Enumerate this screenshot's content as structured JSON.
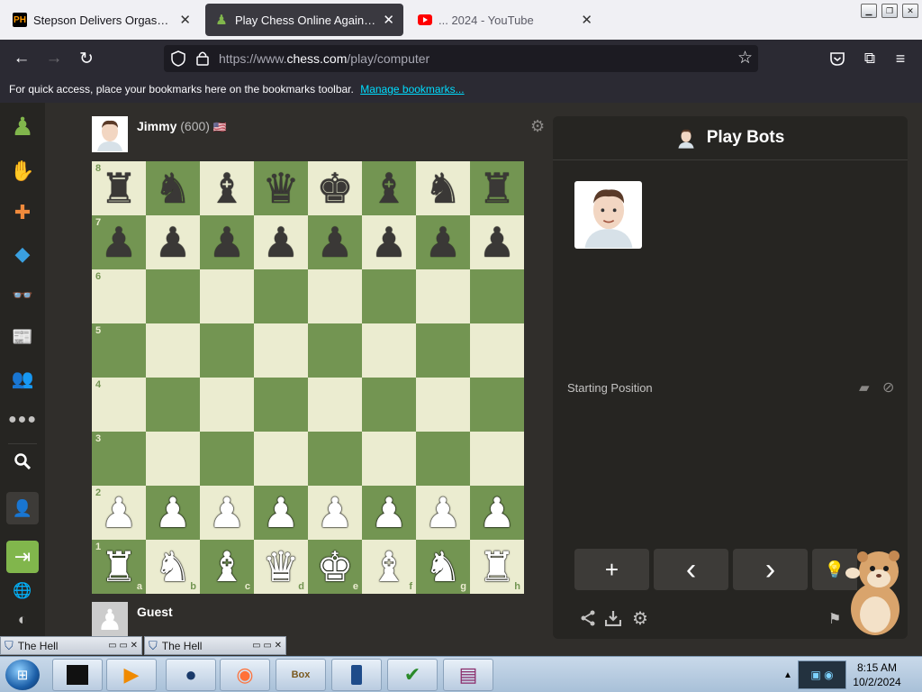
{
  "browser": {
    "tabs": [
      {
        "title": "Stepson Delivers Orgasms to his",
        "favicon": "PH",
        "active": false
      },
      {
        "title": "Play Chess Online Against the C",
        "favicon": "chess-pawn-icon",
        "active": true
      },
      {
        "title": "... 2024 - YouTube",
        "favicon": "youtube-icon",
        "active": false
      }
    ],
    "url_prefix": "https://www.",
    "url_domain": "chess.com",
    "url_path": "/play/computer",
    "bookmarks_text": "For quick access, place your bookmarks here on the bookmarks toolbar.",
    "manage_bookmarks": "Manage bookmarks..."
  },
  "sidebar": {
    "items": [
      "play-icon",
      "puzzles-icon",
      "learn-icon",
      "watch-icon",
      "news-icon",
      "social-icon",
      "more-icon",
      "search-icon",
      "sign-up-icon",
      "login-icon",
      "language-icon",
      "theme-icon"
    ]
  },
  "game": {
    "opponent_name": "Jimmy",
    "opponent_rating": "(600)",
    "opponent_flag": "🇺🇸",
    "player_name": "Guest",
    "board": {
      "ranks": [
        "8",
        "7",
        "6",
        "5",
        "4",
        "3",
        "2",
        "1"
      ],
      "files": [
        "a",
        "b",
        "c",
        "d",
        "e",
        "f",
        "g",
        "h"
      ],
      "position": [
        [
          "♜",
          "♞",
          "♝",
          "♛",
          "♚",
          "♝",
          "♞",
          "♜"
        ],
        [
          "♟",
          "♟",
          "♟",
          "♟",
          "♟",
          "♟",
          "♟",
          "♟"
        ],
        [
          "",
          "",
          "",
          "",
          "",
          "",
          "",
          ""
        ],
        [
          "",
          "",
          "",
          "",
          "",
          "",
          "",
          ""
        ],
        [
          "",
          "",
          "",
          "",
          "",
          "",
          "",
          ""
        ],
        [
          "",
          "",
          "",
          "",
          "",
          "",
          "",
          ""
        ],
        [
          "♟",
          "♟",
          "♟",
          "♟",
          "♟",
          "♟",
          "♟",
          "♟"
        ],
        [
          "♜",
          "♞",
          "♝",
          "♛",
          "♚",
          "♝",
          "♞",
          "♜"
        ]
      ],
      "colors": {
        "light": "#ebecd0",
        "dark": "#739552"
      }
    }
  },
  "panel": {
    "title": "Play Bots",
    "status": "Starting Position",
    "controls": [
      "+",
      "‹",
      "›",
      "💡"
    ]
  },
  "taskbar": {
    "windows": [
      {
        "title": "The Hell"
      },
      {
        "title": "The Hell"
      }
    ],
    "apps": [
      "cube-app-icon",
      "media-player-icon",
      "globe-app-icon",
      "firefox-icon",
      "box-game-icon",
      "phone-app-icon",
      "checklist-icon",
      "winrar-icon"
    ],
    "time": "8:15 AM",
    "date": "10/2/2024"
  }
}
